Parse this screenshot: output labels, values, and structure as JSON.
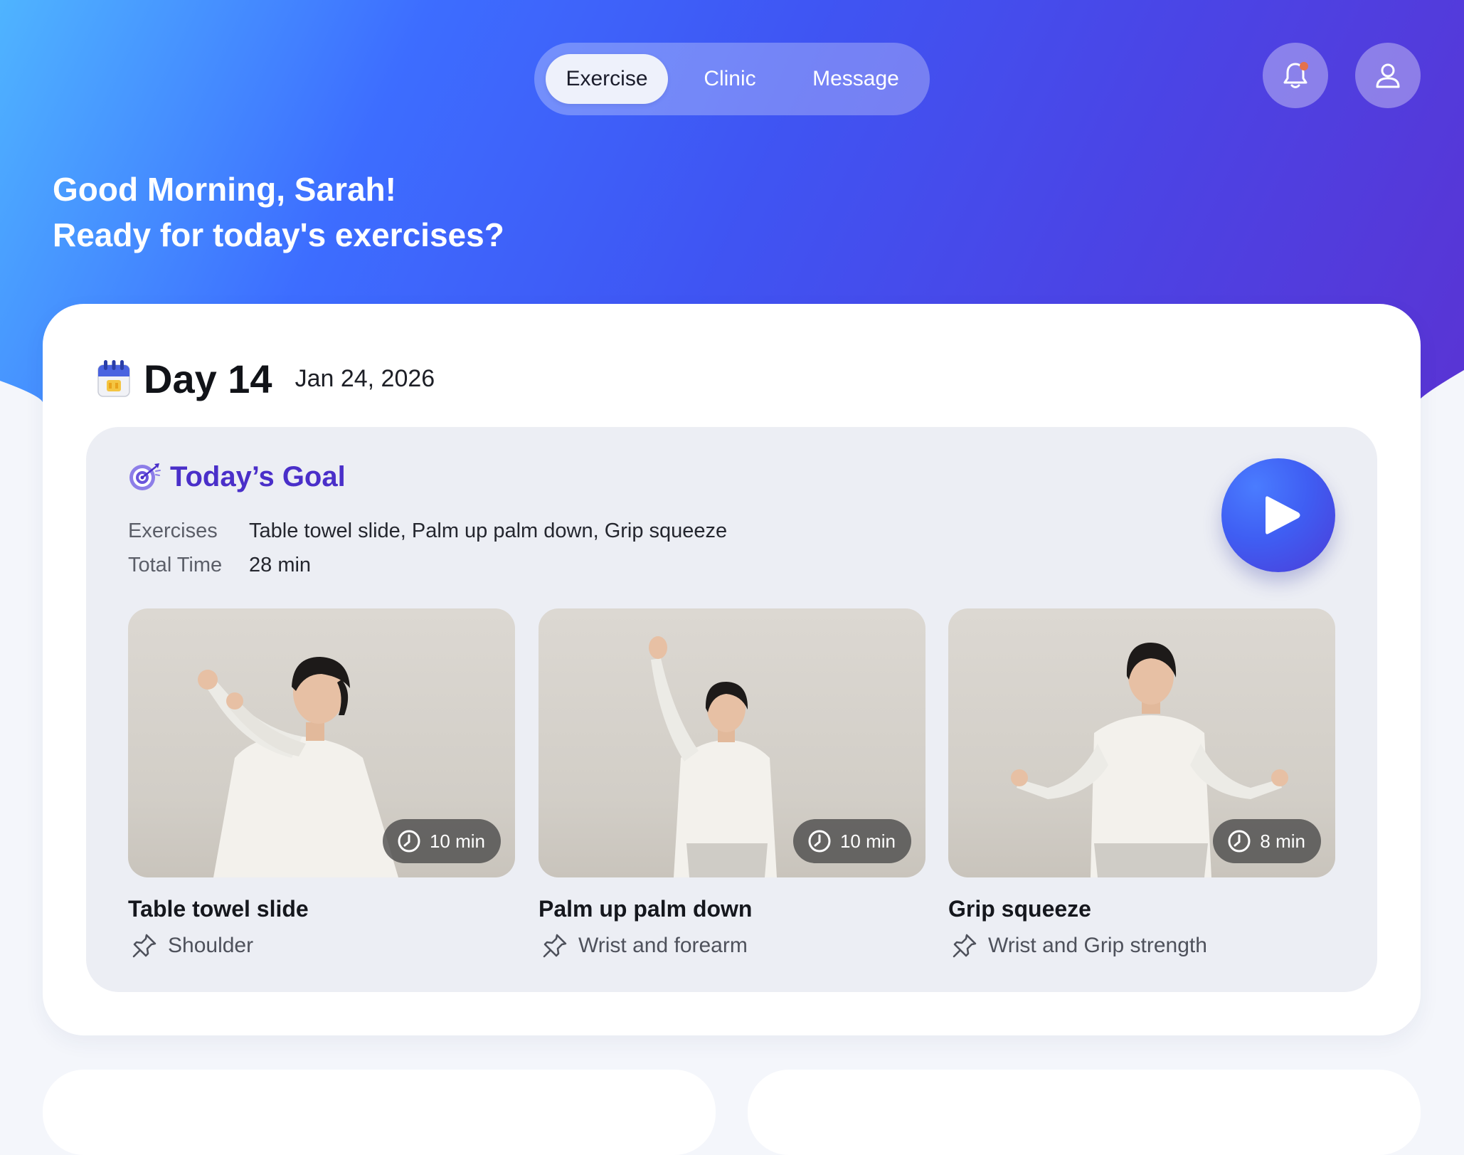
{
  "nav": {
    "tabs": [
      {
        "label": "Exercise",
        "active": true
      },
      {
        "label": "Clinic",
        "active": false
      },
      {
        "label": "Message",
        "active": false
      }
    ],
    "notification_icon": "bell-icon",
    "notification_dot_color": "#e4714b",
    "profile_icon": "user-icon"
  },
  "greeting": {
    "line1": "Good Morning, Sarah!",
    "line2": "Ready for today's exercises?"
  },
  "day": {
    "icon": "calendar-icon",
    "title": "Day 14",
    "date": "Jan 24, 2026"
  },
  "goal": {
    "icon": "target-icon",
    "title": "Today’s Goal",
    "exercises_label": "Exercises",
    "exercises_value": "Table towel slide, Palm up palm down, Grip squeeze",
    "time_label": "Total Time",
    "time_value": "28 min",
    "play_icon": "play-icon"
  },
  "exercises": [
    {
      "name": "Table towel slide",
      "area": "Shoulder",
      "duration": "10 min"
    },
    {
      "name": "Palm up palm down",
      "area": "Wrist and forearm",
      "duration": "10 min"
    },
    {
      "name": "Grip squeeze",
      "area": "Wrist and Grip strength",
      "duration": "8 min"
    }
  ],
  "colors": {
    "accent": "#3f5ef3",
    "goal_title": "#4a2fc9",
    "gradient_start": "#4fb4ff",
    "gradient_end": "#5934d4"
  }
}
